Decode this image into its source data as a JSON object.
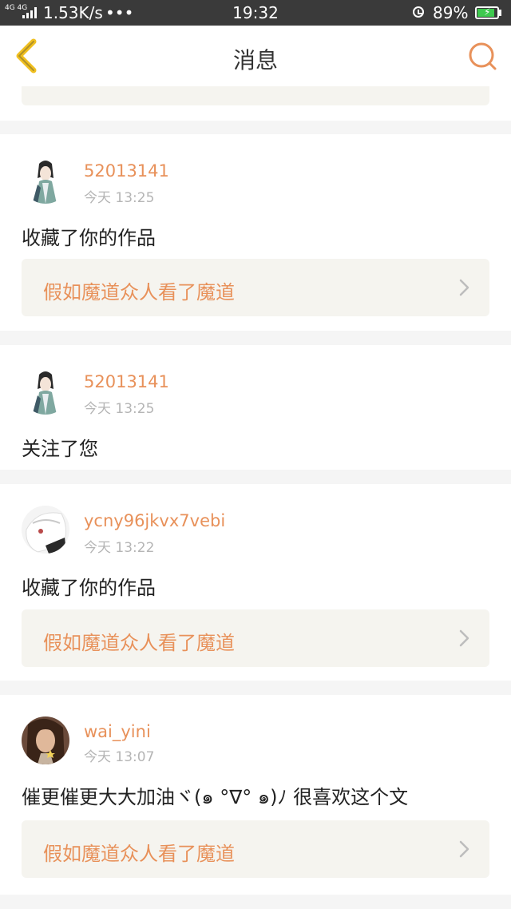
{
  "status_bar": {
    "network_type": "4G 4G",
    "speed": "1.53K/s",
    "more": "•••",
    "time": "19:32",
    "battery": "89%",
    "battery_level": 0.89
  },
  "header": {
    "title": "消息",
    "back_icon": "chevron-left-icon",
    "search_icon": "search-icon"
  },
  "colors": {
    "accent": "#e8915a",
    "back_icon": "#f0c020",
    "link_bg": "#f5f4ef",
    "timestamp": "#b5b5b5"
  },
  "notifications": [
    {
      "username": "52013141",
      "time": "今天 13:25",
      "message": "收藏了你的作品",
      "work_title": "假如魔道众人看了魔道",
      "avatar": "anime-girl-avatar"
    },
    {
      "username": "52013141",
      "time": "今天 13:25",
      "message": "关注了您",
      "work_title": null,
      "avatar": "anime-girl-avatar"
    },
    {
      "username": "ycny96jkvx7vebi",
      "time": "今天 13:22",
      "message": "收藏了你的作品",
      "work_title": "假如魔道众人看了魔道",
      "avatar": "white-hair-avatar"
    },
    {
      "username": "wai_yini",
      "time": "今天 13:07",
      "message": "催更催更大大加油ヾ(๑ °∇° ๑)ﾉ 很喜欢这个文",
      "work_title": "假如魔道众人看了魔道",
      "avatar": "portrait-avatar"
    }
  ]
}
